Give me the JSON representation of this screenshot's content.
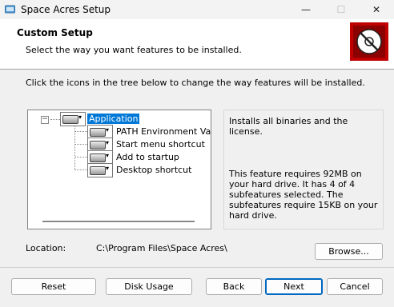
{
  "window": {
    "title": "Space Acres Setup",
    "controls": {
      "minimize": "—",
      "maximize": "☐",
      "close": "✕"
    }
  },
  "header": {
    "title": "Custom Setup",
    "subtitle": "Select the way you want features to be installed."
  },
  "instruction": "Click the icons in the tree below to change the way features will be installed.",
  "tree": {
    "root": {
      "label": "Application",
      "expander": "−"
    },
    "children": [
      {
        "label": "PATH Environment Variable"
      },
      {
        "label": "Start menu shortcut"
      },
      {
        "label": "Add to startup"
      },
      {
        "label": "Desktop shortcut"
      }
    ],
    "dropdown_glyph": "▾"
  },
  "description": {
    "summary": "Installs all binaries and the license.",
    "requirements": "This feature requires 92MB on your hard drive. It has 4 of 4 subfeatures selected. The subfeatures require 15KB on your hard drive."
  },
  "location": {
    "label": "Location:",
    "path": "C:\\Program Files\\Space Acres\\"
  },
  "buttons": {
    "browse": "Browse...",
    "reset": "Reset",
    "disk_usage": "Disk Usage",
    "back": "Back",
    "next": "Next",
    "cancel": "Cancel"
  },
  "colors": {
    "accent": "#0078d7",
    "logo_bg": "#c00000"
  }
}
